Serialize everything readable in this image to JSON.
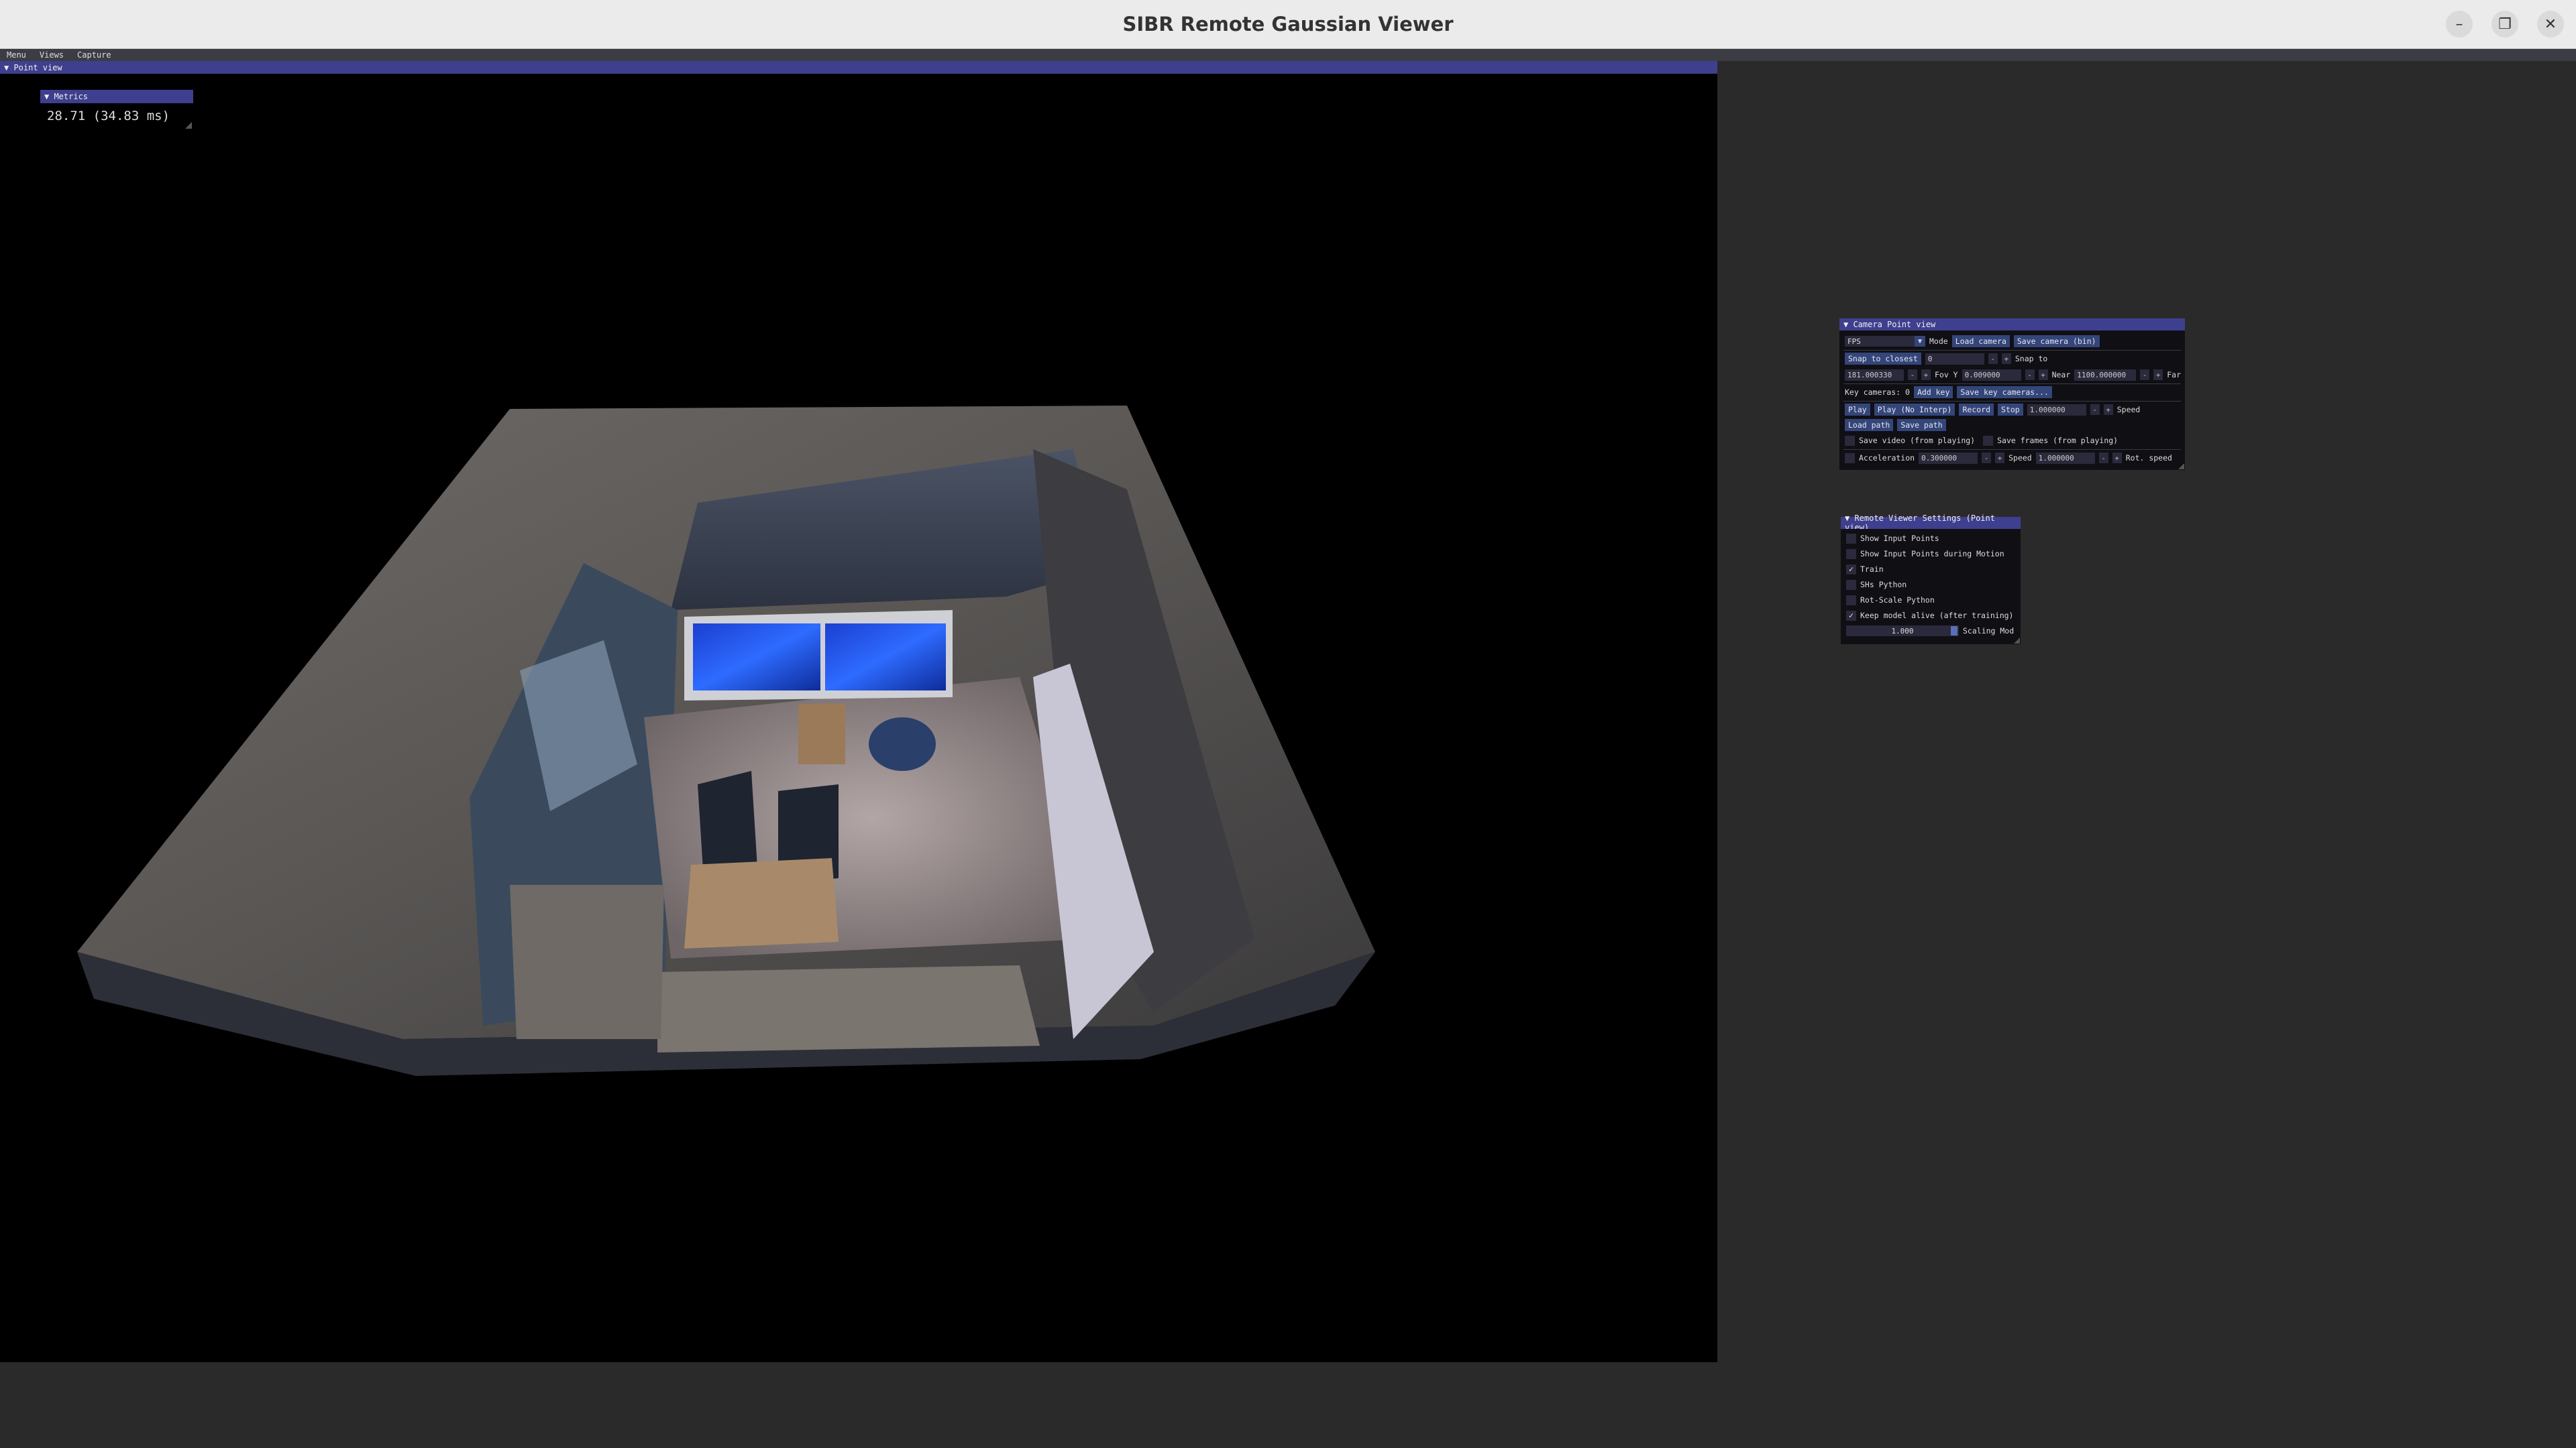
{
  "window": {
    "title": "SIBR Remote Gaussian Viewer",
    "minimize_icon": "minimize-icon",
    "maximize_icon": "maximize-icon",
    "close_icon": "close-icon"
  },
  "menubar": {
    "items": [
      "Menu",
      "Views",
      "Capture"
    ]
  },
  "point_view": {
    "header": "▼ Point view"
  },
  "metrics": {
    "header": "▼ Metrics",
    "value": "28.71 (34.83 ms)"
  },
  "camera_panel": {
    "header": "▼ Camera Point view",
    "mode_value": "FPS",
    "mode_label": "Mode",
    "load_camera": "Load camera",
    "save_camera": "Save camera (bin)",
    "snap_to_closest": "Snap to closest",
    "snap_value": "0",
    "snap_to": "Snap to",
    "fov_value": "181.000330",
    "fov_label": "Fov Y",
    "near_value": "0.009000",
    "near_label": "Near",
    "far_value": "1100.000000",
    "far_label": "Far",
    "key_cameras": "Key cameras: 0",
    "add_key": "Add key",
    "save_key_cameras": "Save key cameras...",
    "play": "Play",
    "play_no_interp": "Play (No Interp)",
    "record": "Record",
    "stop": "Stop",
    "speed_value": "1.000000",
    "speed_label": "Speed",
    "load_path": "Load path",
    "save_path": "Save path",
    "save_video": "Save video (from playing)",
    "save_frames": "Save frames (from playing)",
    "acceleration_label": "Acceleration",
    "acceleration_value": "0.300000",
    "speed2_label": "Speed",
    "speed2_value": "1.000000",
    "rot_speed_label": "Rot. speed"
  },
  "settings_panel": {
    "header": "▼ Remote Viewer Settings (Point view)",
    "checkboxes": [
      {
        "label": "Show Input Points",
        "checked": false
      },
      {
        "label": "Show Input Points during Motion",
        "checked": false
      },
      {
        "label": "Train",
        "checked": true
      },
      {
        "label": "SHs Python",
        "checked": false
      },
      {
        "label": "Rot-Scale Python",
        "checked": false
      },
      {
        "label": "Keep model alive (after training)",
        "checked": true
      }
    ],
    "scaling_value": "1.000",
    "scaling_label": "Scaling Mod"
  }
}
